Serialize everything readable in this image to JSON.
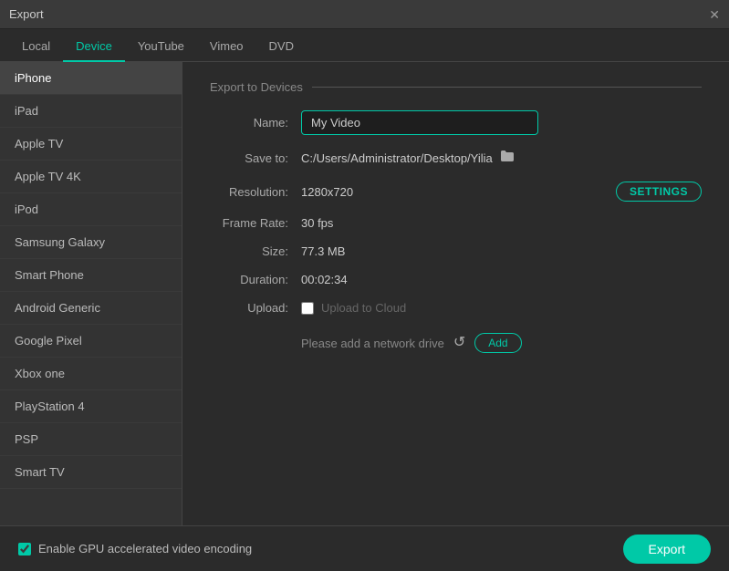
{
  "window": {
    "title": "Export",
    "close_label": "✕"
  },
  "tabs": [
    {
      "id": "local",
      "label": "Local",
      "active": false
    },
    {
      "id": "device",
      "label": "Device",
      "active": true
    },
    {
      "id": "youtube",
      "label": "YouTube",
      "active": false
    },
    {
      "id": "vimeo",
      "label": "Vimeo",
      "active": false
    },
    {
      "id": "dvd",
      "label": "DVD",
      "active": false
    }
  ],
  "sidebar": {
    "items": [
      {
        "id": "iphone",
        "label": "iPhone",
        "active": true
      },
      {
        "id": "ipad",
        "label": "iPad",
        "active": false
      },
      {
        "id": "apple-tv",
        "label": "Apple TV",
        "active": false
      },
      {
        "id": "apple-tv-4k",
        "label": "Apple TV 4K",
        "active": false
      },
      {
        "id": "ipod",
        "label": "iPod",
        "active": false
      },
      {
        "id": "samsung-galaxy",
        "label": "Samsung Galaxy",
        "active": false
      },
      {
        "id": "smart-phone",
        "label": "Smart Phone",
        "active": false
      },
      {
        "id": "android-generic",
        "label": "Android Generic",
        "active": false
      },
      {
        "id": "google-pixel",
        "label": "Google Pixel",
        "active": false
      },
      {
        "id": "xbox-one",
        "label": "Xbox one",
        "active": false
      },
      {
        "id": "playstation-4",
        "label": "PlayStation 4",
        "active": false
      },
      {
        "id": "psp",
        "label": "PSP",
        "active": false
      },
      {
        "id": "smart-tv",
        "label": "Smart TV",
        "active": false
      }
    ]
  },
  "main": {
    "section_title": "Export to Devices",
    "name_label": "Name:",
    "name_value": "My Video",
    "save_to_label": "Save to:",
    "save_to_path": "C:/Users/Administrator/Desktop/Yilia",
    "resolution_label": "Resolution:",
    "resolution_value": "1280x720",
    "settings_btn_label": "SETTINGS",
    "frame_rate_label": "Frame Rate:",
    "frame_rate_value": "30 fps",
    "size_label": "Size:",
    "size_value": "77.3 MB",
    "duration_label": "Duration:",
    "duration_value": "00:02:34",
    "upload_label": "Upload:",
    "upload_cloud_label": "Upload to Cloud",
    "network_drive_text": "Please add a network drive",
    "refresh_icon": "↺",
    "add_btn_label": "Add",
    "folder_icon": "📁"
  },
  "bottom": {
    "gpu_label": "Enable GPU accelerated video encoding",
    "export_btn_label": "Export"
  }
}
